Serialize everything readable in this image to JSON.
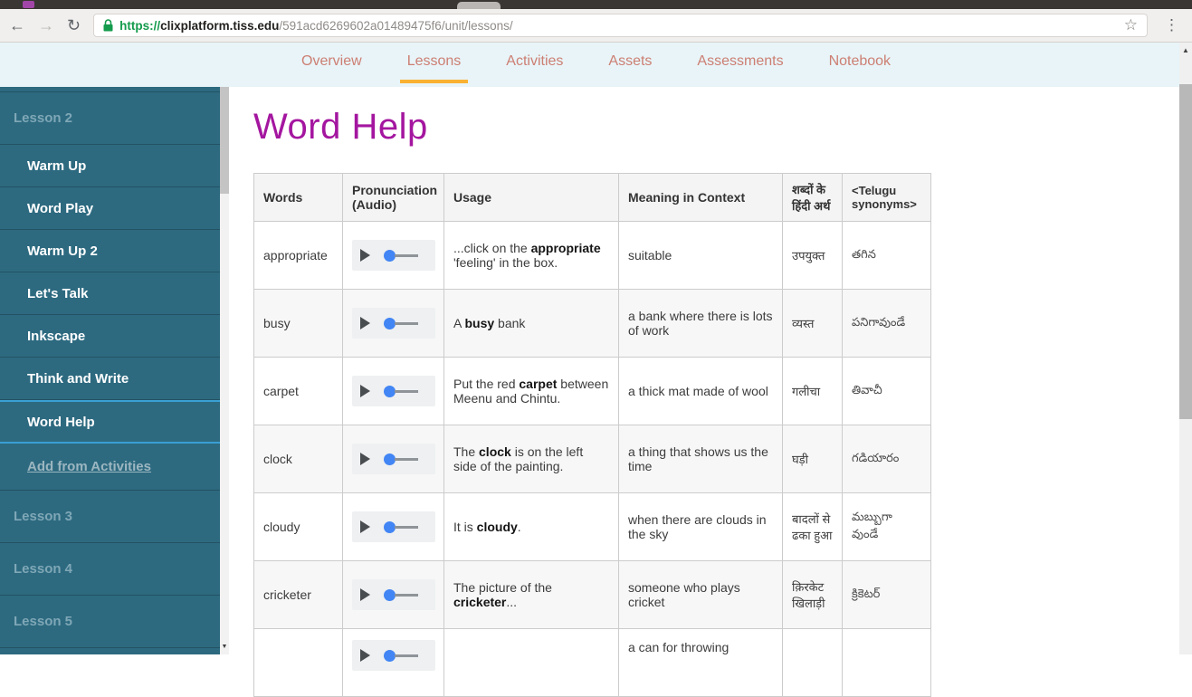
{
  "browser": {
    "url": {
      "scheme": "https://",
      "domain": "clixplatform.tiss.edu",
      "path": "/591acd6269602a01489475f6/unit/lessons/"
    }
  },
  "icons": {
    "back": "←",
    "forward": "→",
    "reload": "↻",
    "bookmark": "☆",
    "menu": "⋮",
    "scroll_up": "▲",
    "scroll_down": "▼",
    "lock": "padlock",
    "play": "play-triangle"
  },
  "nav": {
    "tabs": [
      {
        "label": "Overview",
        "active": false
      },
      {
        "label": "Lessons",
        "active": true
      },
      {
        "label": "Activities",
        "active": false
      },
      {
        "label": "Assets",
        "active": false
      },
      {
        "label": "Assessments",
        "active": false
      },
      {
        "label": "Notebook",
        "active": false
      }
    ]
  },
  "sidebar": {
    "items": [
      {
        "label": "Lesson 2",
        "type": "header",
        "active": false
      },
      {
        "label": "Warm Up",
        "type": "sub",
        "active": false
      },
      {
        "label": "Word Play",
        "type": "sub",
        "active": false
      },
      {
        "label": "Warm Up 2",
        "type": "sub",
        "active": false
      },
      {
        "label": "Let's Talk",
        "type": "sub",
        "active": false
      },
      {
        "label": "Inkscape",
        "type": "sub",
        "active": false
      },
      {
        "label": "Think and Write",
        "type": "sub",
        "active": false
      },
      {
        "label": "Word Help",
        "type": "sub",
        "active": true
      },
      {
        "label": "Add from Activities",
        "type": "link",
        "active": false
      },
      {
        "label": "Lesson 3",
        "type": "header",
        "active": false
      },
      {
        "label": "Lesson 4",
        "type": "header",
        "active": false
      },
      {
        "label": "Lesson 5",
        "type": "header",
        "active": false
      }
    ]
  },
  "main": {
    "title": "Word Help",
    "table": {
      "headers": [
        "Words",
        "Pronunciation (Audio)",
        "Usage",
        "Meaning in Context",
        "शब्दों के हिंदी अर्थ",
        "<Telugu synonyms>"
      ],
      "rows": [
        {
          "word": "appropriate",
          "usage": [
            "...click on the ",
            "appropriate",
            " 'feeling' in the box."
          ],
          "meaning": "suitable",
          "hindi": "उपयुक्त",
          "telugu": "తగిన"
        },
        {
          "word": "busy",
          "usage": [
            "A ",
            "busy",
            " bank"
          ],
          "meaning": "a bank where there is lots of work",
          "hindi": "व्यस्त",
          "telugu": "పనిగావుండే"
        },
        {
          "word": "carpet",
          "usage": [
            "Put the red ",
            "carpet",
            " between Meenu and Chintu."
          ],
          "meaning": "a thick mat made of wool",
          "hindi": "गलीचा",
          "telugu": "తివాచీ"
        },
        {
          "word": "clock",
          "usage": [
            "The ",
            "clock",
            " is on the left side of the painting."
          ],
          "meaning": "a thing that shows us the time",
          "hindi": "घड़ी",
          "telugu": "గడియారం"
        },
        {
          "word": "cloudy",
          "usage": [
            "It is ",
            "cloudy",
            "."
          ],
          "meaning": "when there are clouds in the sky",
          "hindi": "बादलों से ढका हुआ",
          "telugu": "మబ్బుగా వుండే"
        },
        {
          "word": "cricketer",
          "usage": [
            "The picture of the ",
            "cricketer",
            "..."
          ],
          "meaning": "someone who plays cricket",
          "hindi": "क़िरकेट खिलाड़ी",
          "telugu": "క్రికెటర్"
        },
        {
          "word": "",
          "usage": [
            "",
            "",
            ""
          ],
          "meaning": "a can for throwing",
          "hindi": "",
          "telugu": ""
        }
      ]
    }
  },
  "colors": {
    "tabstrip_bg": "#3a3633",
    "toolbar_bg": "#f1efed",
    "url_secure_green": "#149b4c",
    "nav_bg": "#e8f4f8",
    "nav_tab_text": "#cd7f73",
    "nav_active_underline": "#f9b233",
    "sidebar_bg": "#2d6a80",
    "sidebar_header_text": "#7fa7b6",
    "sidebar_active_border": "#3aa0d4",
    "title_magenta": "#a4169f",
    "audio_knob_blue": "#4285f4",
    "table_border": "#cccccc"
  }
}
